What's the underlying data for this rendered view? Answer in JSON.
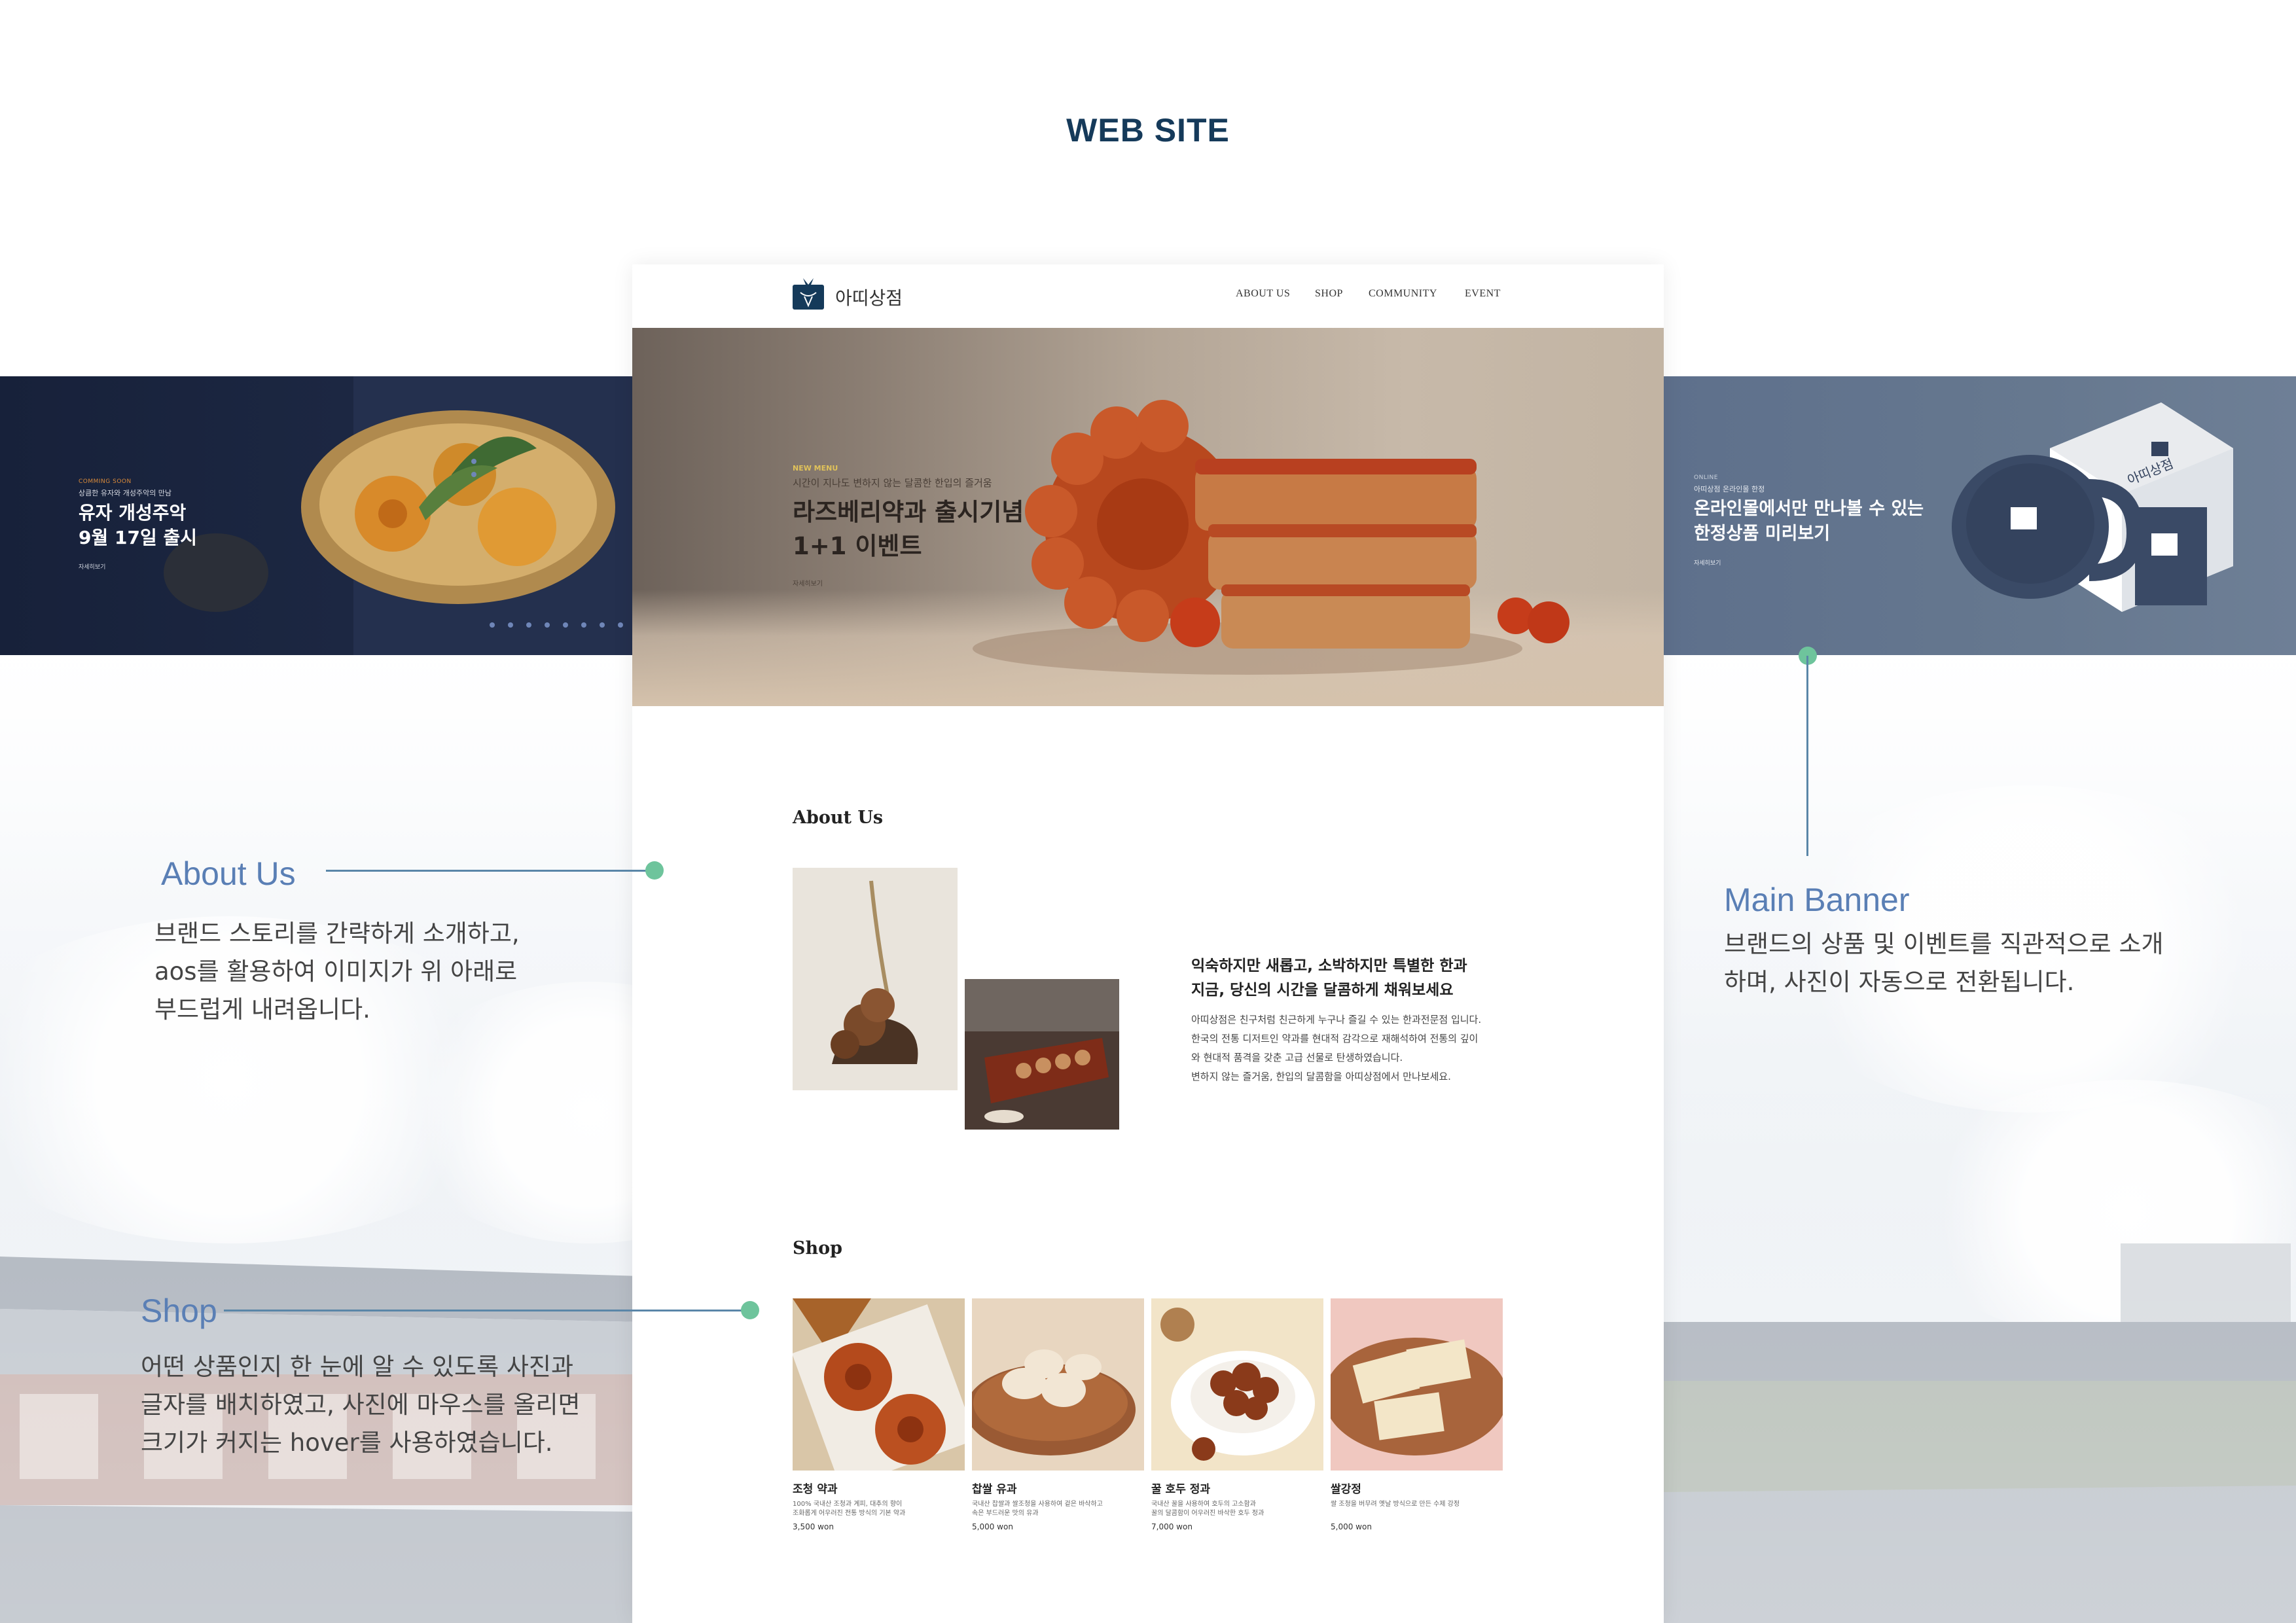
{
  "page": {
    "title": "WEB SITE"
  },
  "site": {
    "brand": "아띠상점",
    "nav": [
      "ABOUT US",
      "SHOP",
      "COMMUNITY",
      "EVENT"
    ],
    "hero": {
      "eyebrow": "NEW MENU",
      "subtitle": "시간이 지나도 변하지 않는 달콤한 한입의 즐거움",
      "title_line1": "라즈베리약과 출시기념",
      "title_line2": "1+1 이벤트",
      "more": "자세히보기"
    },
    "about": {
      "title": "About Us",
      "headline_line1": "익숙하지만 새롭고, 소박하지만 특별한 한과",
      "headline_line2": "지금, 당신의 시간을 달콤하게 채워보세요",
      "body": [
        "아띠상점은 친구처럼 친근하게 누구나 즐길 수 있는 한과전문점 입니다.",
        "한국의 전통 디저트인 약과를 현대적 감각으로 재해석하여 전통의 깊이",
        "와 현대적 품격을 갖춘 고급 선물로 탄생하였습니다.",
        "변하지 않는 즐거움, 한입의 달콤함을 아띠상점에서 만나보세요."
      ]
    },
    "shop": {
      "title": "Shop",
      "products": [
        {
          "name": "조청 약과",
          "desc_line1": "100% 국내산 조청과 계피, 대추의 향이",
          "desc_line2": "조화롭게 어우러진 전통 방식의 기본 약과",
          "price": "3,500 won"
        },
        {
          "name": "찹쌀 유과",
          "desc_line1": "국내산 찹쌀과 쌀조청을 사용하여 겉은 바삭하고",
          "desc_line2": "속은 부드러운 맛의 유과",
          "price": "5,000 won"
        },
        {
          "name": "꿀 호두 정과",
          "desc_line1": "국내산 꿀을 사용하여 호두의 고소함과",
          "desc_line2": "꿀의 달콤함이 어우러진 바삭한 호두 정과",
          "price": "7,000 won"
        },
        {
          "name": "쌀강정",
          "desc_line1": "쌀 조청을 버무려 옛날 방식으로 만든 수제 강정",
          "desc_line2": "",
          "price": "5,000 won"
        }
      ]
    }
  },
  "banner_left": {
    "eyebrow": "COMMING SOON",
    "subtitle": "상큼한 유자와 개성주악의 만남",
    "title_line1": "유자 개성주악",
    "title_line2": "9월 17일 출시",
    "more": "자세히보기"
  },
  "banner_right": {
    "eyebrow": "ONLINE",
    "subtitle": "아띠상점 온라인몰 한정",
    "title_line1": "온라인몰에서만 만나볼 수 있는",
    "title_line2": "한정상품 미리보기",
    "more": "자세히보기",
    "box_brand": "아띠상점"
  },
  "annotations": {
    "about": {
      "title": "About Us",
      "lines": [
        "브랜드 스토리를 간략하게 소개하고,",
        "aos를 활용하여 이미지가 위 아래로",
        "부드럽게 내려옵니다."
      ]
    },
    "shop": {
      "title": "Shop",
      "lines": [
        "어떤 상품인지 한 눈에 알 수 있도록 사진과",
        "글자를 배치하였고, 사진에 마우스를 올리면",
        "크기가 커지는 hover를 사용하였습니다."
      ]
    },
    "banner": {
      "title": "Main Banner",
      "lines": [
        "브랜드의 상품 및 이벤트를 직관적으로 소개",
        "하며, 사진이 자동으로 전환됩니다."
      ]
    }
  },
  "colors": {
    "title": "#153a5a",
    "annotation": "#5a7fb5",
    "dot": "#6ec49c",
    "line": "#5a86a8",
    "hero_eyebrow": "#e0c25a"
  }
}
